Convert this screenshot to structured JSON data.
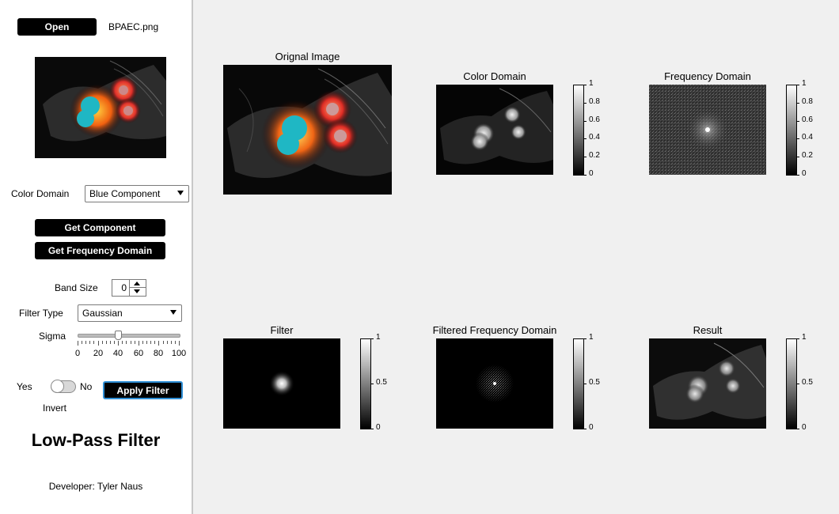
{
  "left_panel": {
    "open_button": "Open",
    "file_name": "BPAEC.png",
    "color_domain_label": "Color Domain",
    "color_domain_value": "Blue Component",
    "get_component_button": "Get Component",
    "get_frequency_button": "Get Frequency Domain",
    "band_size_label": "Band Size",
    "band_size_value": "0",
    "filter_type_label": "Filter Type",
    "filter_type_value": "Gaussian",
    "sigma_label": "Sigma",
    "sigma_value": 40,
    "sigma_ticks": [
      "0",
      "20",
      "40",
      "60",
      "80",
      "100"
    ],
    "toggle_yes": "Yes",
    "toggle_no": "No",
    "invert_label": "Invert",
    "apply_button": "Apply Filter",
    "app_title": "Low-Pass Filter",
    "developer": "Developer: Tyler Naus"
  },
  "plots": {
    "original": {
      "title": "Orignal Image"
    },
    "color_domain": {
      "title": "Color Domain",
      "ticks": [
        "1",
        "0.8",
        "0.6",
        "0.4",
        "0.2",
        "0"
      ]
    },
    "frequency_domain": {
      "title": "Frequency Domain",
      "ticks": [
        "1",
        "0.8",
        "0.6",
        "0.4",
        "0.2",
        "0"
      ]
    },
    "filter": {
      "title": "Filter",
      "ticks": [
        "1",
        "0.5",
        "0"
      ]
    },
    "filtered_frequency": {
      "title": "Filtered Frequency Domain",
      "ticks": [
        "1",
        "0.5",
        "0"
      ]
    },
    "result": {
      "title": "Result",
      "ticks": [
        "1",
        "0.5",
        "0"
      ]
    }
  }
}
